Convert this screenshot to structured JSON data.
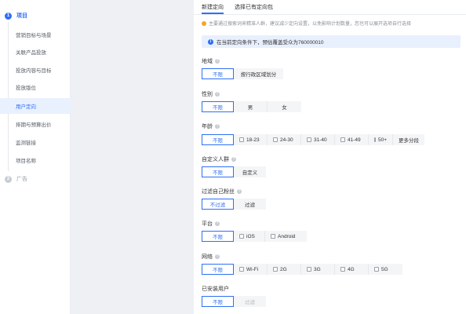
{
  "sidebar": {
    "step1": {
      "num": "1",
      "label": "项目"
    },
    "items": [
      {
        "label": "营销目标与场景"
      },
      {
        "label": "关联产品投放"
      },
      {
        "label": "投放内容与目标"
      },
      {
        "label": "投放版位"
      },
      {
        "label": "用户定向"
      },
      {
        "label": "排期与预算出价"
      },
      {
        "label": "监测链接"
      },
      {
        "label": "项目名称"
      }
    ],
    "step2": {
      "num": "2",
      "label": "广告"
    }
  },
  "tabs": [
    {
      "label": "新建定向"
    },
    {
      "label": "选择已有定向包"
    }
  ],
  "tip": "主要通过搜索词来精准人群，建议减少定向设置，以免影响计划数量，您也可以展开选项自行选择",
  "info": "在当前定向条件下，预估覆盖受众为760000010",
  "sections": {
    "region": {
      "title": "地域",
      "options": [
        "不限",
        "按行政区域划分"
      ]
    },
    "gender": {
      "title": "性别",
      "options": [
        "不限",
        "男",
        "女"
      ]
    },
    "age": {
      "title": "年龄",
      "options": [
        "不限",
        "18-23",
        "24-30",
        "31-40",
        "41-49",
        "50+",
        "更多分段"
      ]
    },
    "custom": {
      "title": "自定义人群",
      "options": [
        "不限",
        "自定义"
      ]
    },
    "filter_fans": {
      "title": "过滤自己粉丝",
      "options": [
        "不过滤",
        "过滤"
      ]
    },
    "platform": {
      "title": "平台",
      "options": [
        "不限",
        "iOS",
        "Android"
      ]
    },
    "network": {
      "title": "网络",
      "options": [
        "不限",
        "Wi-Fi",
        "2G",
        "3G",
        "4G",
        "5G"
      ]
    },
    "installed": {
      "title": "已安装用户",
      "options": [
        "不限",
        "过滤"
      ]
    }
  },
  "colors": {
    "accent": "#2f6ff5",
    "info_bg": "#e8f0fe",
    "active_nav_bg": "#e9f0fe"
  }
}
